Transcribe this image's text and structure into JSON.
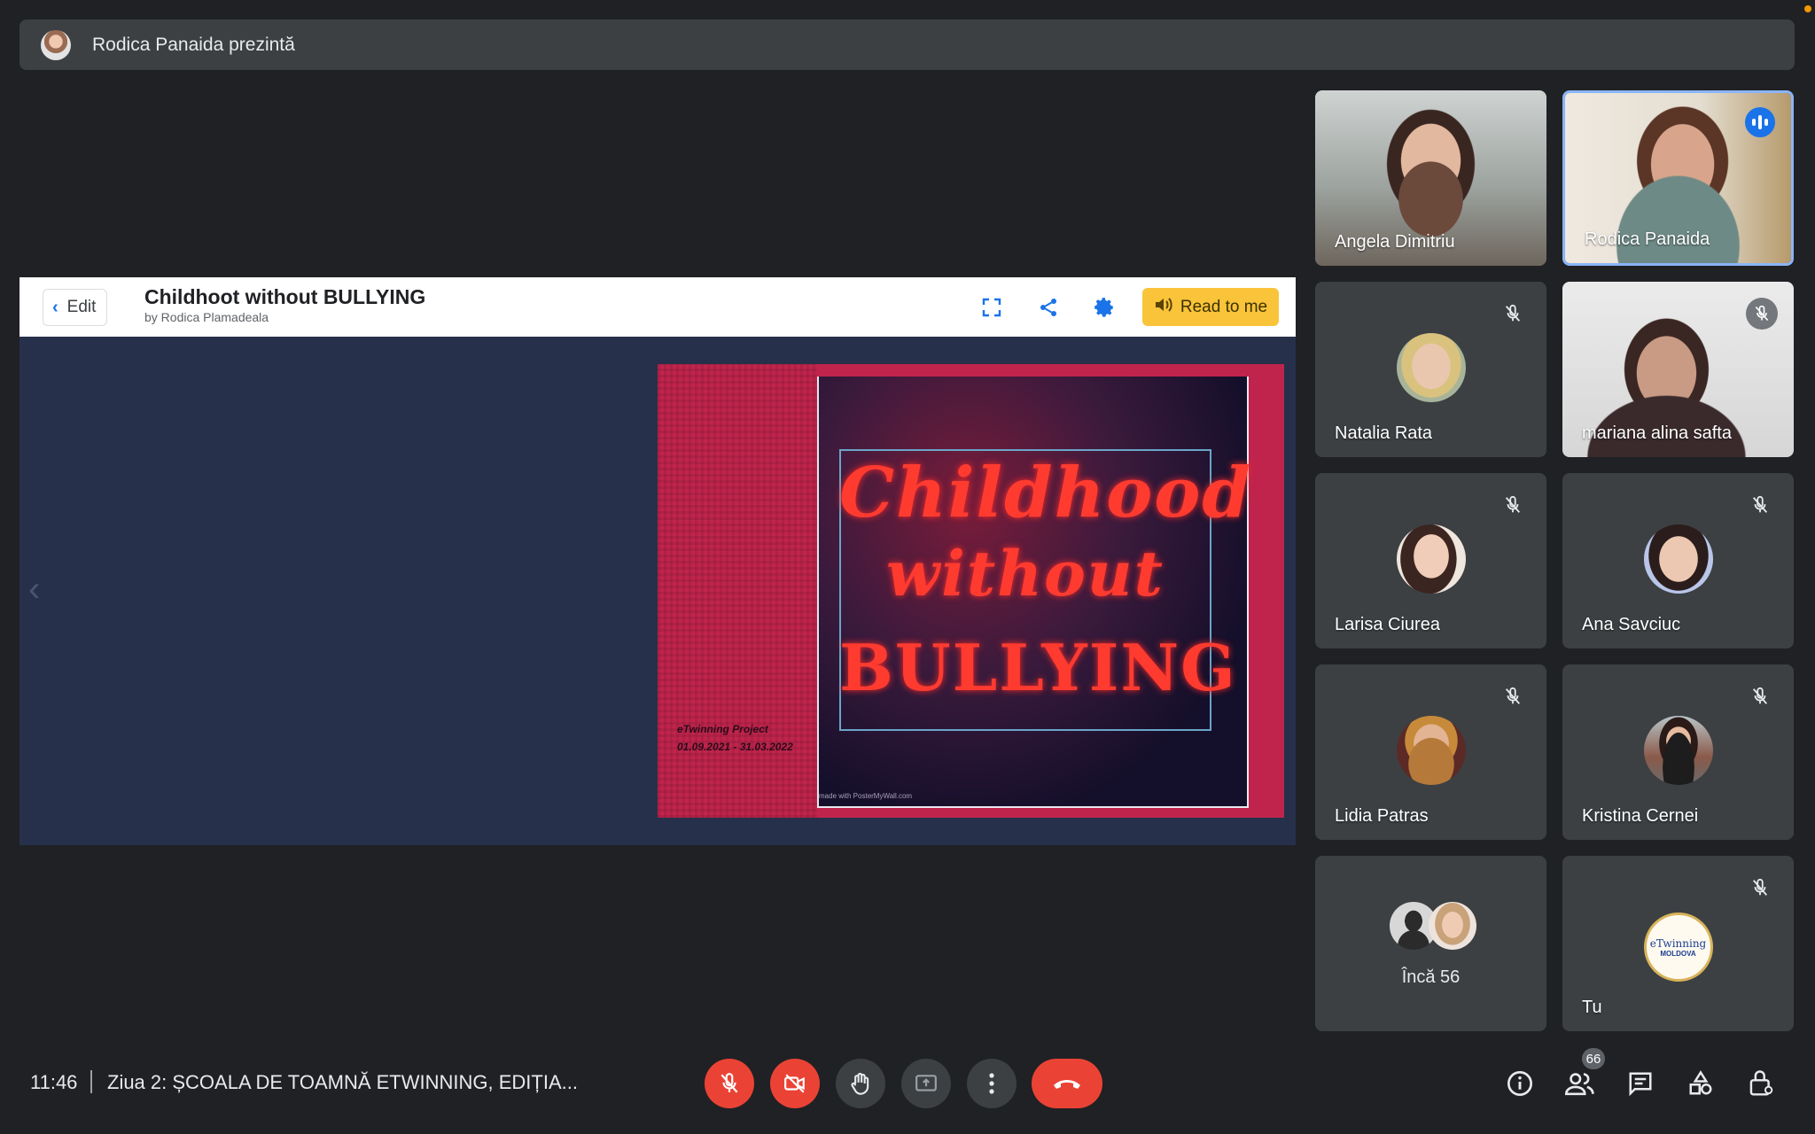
{
  "presenter": {
    "text": "Rodica Panaida prezintă"
  },
  "document": {
    "edit_label": "Edit",
    "title": "Childhoot without BULLYING",
    "author": "by Rodica Plamadeala",
    "read_label": "Read to me",
    "icons": [
      "fullscreen-icon",
      "share-icon",
      "gear-icon",
      "speaker-icon"
    ]
  },
  "slide": {
    "line1": "Childhood",
    "line2": "without",
    "line3": "BULLYING",
    "note_line1": "eTwinning Project",
    "note_line2": "01.09.2021 - 31.03.2022",
    "credit": "made with PosterMyWall.com"
  },
  "participants": [
    {
      "name": "Angela Dimitriu"
    },
    {
      "name": "Rodica Panaida"
    },
    {
      "name": "Natalia Rata"
    },
    {
      "name": "mariana alina safta"
    },
    {
      "name": "Larisa Ciurea"
    },
    {
      "name": "Ana Savciuc"
    },
    {
      "name": "Lidia Patras"
    },
    {
      "name": "Kristina Cernei"
    },
    {
      "name": "Încă 56"
    },
    {
      "name": "Tu"
    }
  ],
  "self_avatar": {
    "line1": "eTwinning",
    "line2": "MOLDOVA"
  },
  "footer": {
    "time": "11:46",
    "meeting_title": "Ziua 2: ȘCOALA DE TOAMNĂ ETWINNING, EDIȚIA...",
    "people_count": "66"
  },
  "colors": {
    "accent": "#8ab4f8",
    "danger": "#ea4335",
    "read_button": "#f9c33a",
    "background": "#202124"
  }
}
